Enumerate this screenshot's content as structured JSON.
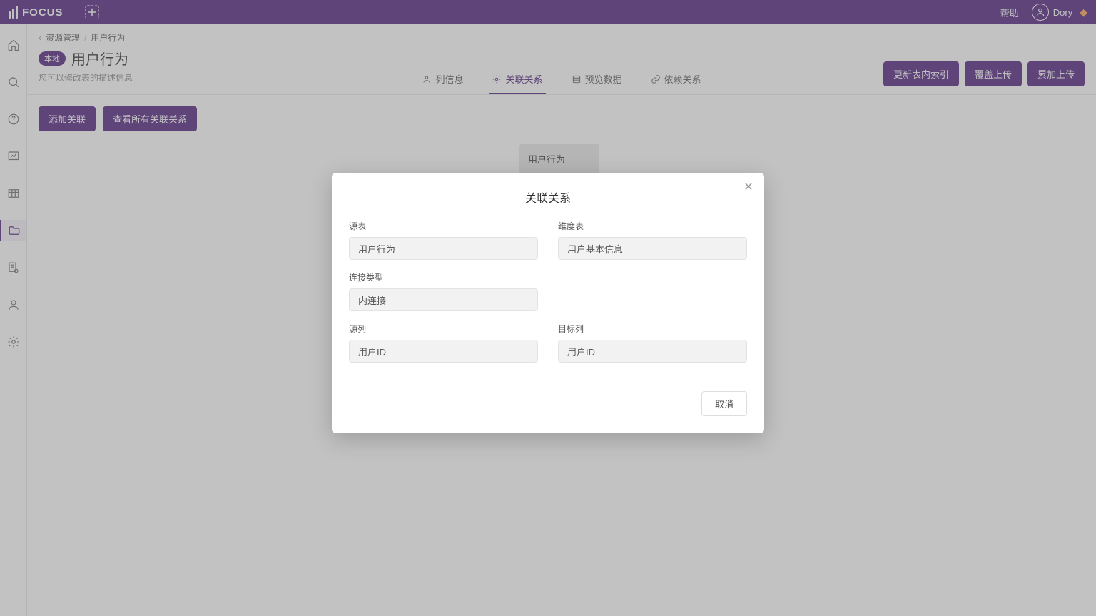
{
  "brand": "FOCUS",
  "topbar": {
    "help": "帮助",
    "user": "Dory"
  },
  "breadcrumb": {
    "a": "资源管理",
    "b": "用户行为"
  },
  "badge": "本地",
  "page_title": "用户行为",
  "subtitle": "您可以修改表的描述信息",
  "tabs": [
    {
      "label": "列信息"
    },
    {
      "label": "关联关系"
    },
    {
      "label": "预览数据"
    },
    {
      "label": "依赖关系"
    }
  ],
  "head_buttons": {
    "b1": "更新表内索引",
    "b2": "覆盖上传",
    "b3": "累加上传"
  },
  "toolbar": {
    "add": "添加关联",
    "viewall": "查看所有关联关系"
  },
  "canvas_card": {
    "title": "用户行为"
  },
  "modal": {
    "title": "关联关系",
    "labels": {
      "source_table": "源表",
      "dim_table": "维度表",
      "join_type": "连接类型",
      "source_col": "源列",
      "target_col": "目标列"
    },
    "values": {
      "source_table": "用户行为",
      "dim_table": "用户基本信息",
      "join_type": "内连接",
      "source_col": "用户ID",
      "target_col": "用户ID"
    },
    "cancel": "取消"
  }
}
